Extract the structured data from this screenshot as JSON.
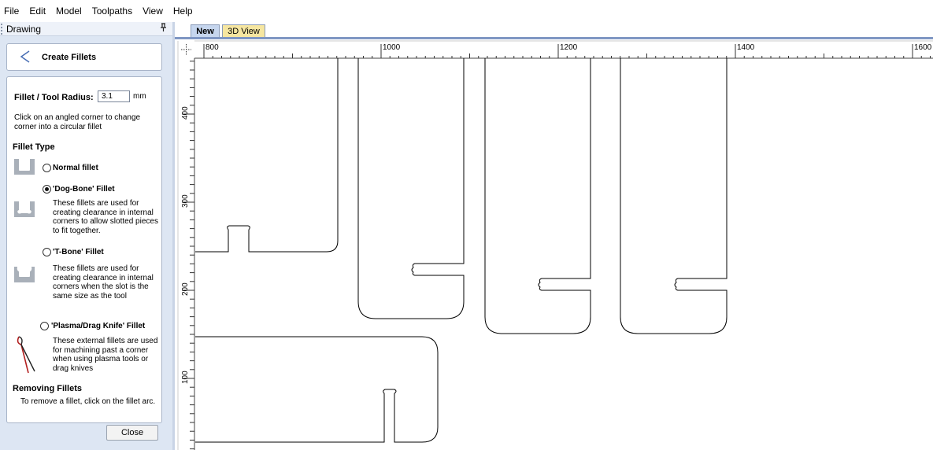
{
  "menu": [
    "File",
    "Edit",
    "Model",
    "Toolpaths",
    "View",
    "Help"
  ],
  "panel": {
    "title": "Drawing",
    "pin": "♈",
    "header_title": "Create Fillets",
    "radius_label": "Fillet / Tool Radius:",
    "radius_value": "3.1",
    "radius_unit": "mm",
    "instruction": "Click on an angled corner to change corner into a circular fillet",
    "fillet_type_heading": "Fillet Type",
    "options": [
      {
        "label": "Normal fillet",
        "selected": false,
        "desc": ""
      },
      {
        "label": "'Dog-Bone' Fillet",
        "selected": true,
        "desc": "These fillets are used for creating clearance in internal corners to allow slotted pieces to fit together."
      },
      {
        "label": "'T-Bone' Fillet",
        "selected": false,
        "desc": "These fillets are used for creating clearance in internal corners when the slot is the same size as the tool"
      },
      {
        "label": "'Plasma/Drag Knife' Fillet",
        "selected": false,
        "desc": "These external fillets are used for machining past a corner when using plasma tools or drag knives"
      }
    ],
    "removing_heading": "Removing Fillets",
    "removing_text": "To remove a fillet, click on the fillet arc.",
    "close_label": "Close"
  },
  "tabs": [
    {
      "label": "New",
      "active": true
    },
    {
      "label": "3D View",
      "active": false
    }
  ],
  "ruler": {
    "h_labels": [
      "800",
      "1000",
      "1200",
      "1400",
      "1600"
    ],
    "v_labels": [
      "400",
      "300",
      "200",
      "100"
    ]
  },
  "colors": {
    "panel_bg": "#dde6f3",
    "tab_active": "#c6d6ee",
    "tab_3d": "#f6e6a0",
    "accent_line": "#7f97c3"
  }
}
